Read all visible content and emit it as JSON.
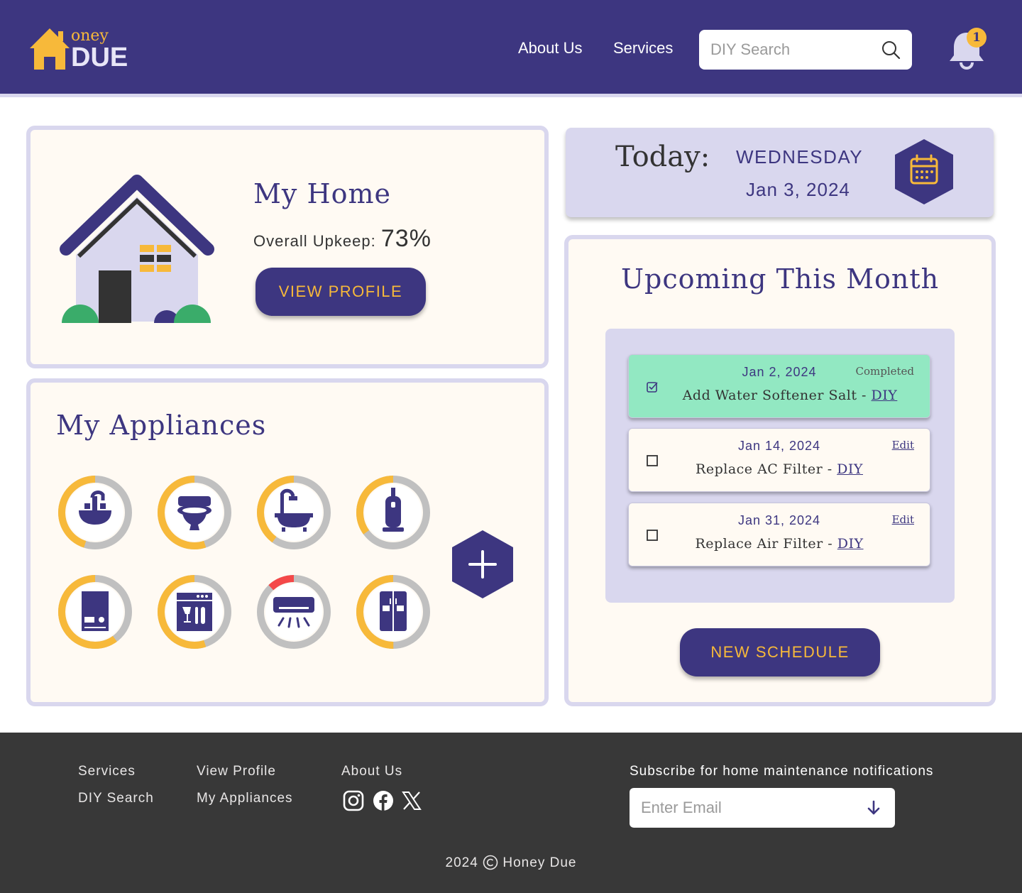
{
  "header": {
    "logo_top": "oney",
    "logo_bottom": "DUE",
    "nav": [
      {
        "label": "About Us",
        "icon": "none"
      },
      {
        "label": "Services",
        "icon": "none"
      }
    ],
    "search_placeholder": "DIY Search",
    "notification_count": "1"
  },
  "home": {
    "title": "My Home",
    "upkeep_label": "Overall Upkeep:",
    "upkeep_value": "73%",
    "view_profile_label": "VIEW PROFILE"
  },
  "appliances": {
    "title": "My Appliances",
    "items": [
      {
        "name": "sink",
        "icon": "sink-icon",
        "level": 0.45,
        "status_color": "#f7b93a"
      },
      {
        "name": "toilet",
        "icon": "toilet-icon",
        "level": 0.55,
        "status_color": "#f7b93a"
      },
      {
        "name": "bathtub",
        "icon": "bathtub-icon",
        "level": 0.4,
        "status_color": "#f7b93a"
      },
      {
        "name": "vacuum",
        "icon": "vacuum-icon",
        "level": 0.35,
        "status_color": "#f7b93a"
      },
      {
        "name": "water-heater",
        "icon": "boiler-icon",
        "level": 0.6,
        "status_color": "#f7b93a"
      },
      {
        "name": "dishwasher",
        "icon": "dishwasher-icon",
        "level": 0.55,
        "status_color": "#f7b93a"
      },
      {
        "name": "air-conditioner",
        "icon": "ac-icon",
        "level": 0.12,
        "status_color": "#f44848"
      },
      {
        "name": "refrigerator",
        "icon": "fridge-icon",
        "level": 0.5,
        "status_color": "#f7b93a"
      }
    ],
    "colors": {
      "track": "#c0c0c0",
      "icon": "#3d3680"
    }
  },
  "today": {
    "label": "Today:",
    "day": "WEDNESDAY",
    "date": "Jan 3, 2024"
  },
  "upcoming": {
    "title": "Upcoming This Month",
    "tasks": [
      {
        "date": "Jan 2, 2024",
        "name": "Add Water Softener Salt - ",
        "link": "DIY",
        "status": "Completed",
        "done": true
      },
      {
        "date": "Jan 14, 2024",
        "name": "Replace AC Filter - ",
        "link": "DIY",
        "status": "Edit",
        "done": false
      },
      {
        "date": "Jan 31, 2024",
        "name": "Replace Air Filter - ",
        "link": "DIY",
        "status": "Edit",
        "done": false
      }
    ],
    "new_schedule_label": "NEW SCHEDULE"
  },
  "footer": {
    "links_col1": [
      "Services",
      "DIY Search"
    ],
    "links_col2": [
      "View Profile",
      "My Appliances"
    ],
    "links_col3": [
      "About Us"
    ],
    "social": [
      "instagram-icon",
      "facebook-icon",
      "x-icon"
    ],
    "subscribe_text": "Subscribe for home maintenance notifications",
    "email_placeholder": "Enter Email",
    "copyright_year": "2024",
    "copyright_owner": "Honey Due"
  },
  "colors": {
    "brand": "#3d3680",
    "accent": "#f7b93a",
    "light": "#d9d7ee",
    "done": "#92e8c2",
    "footer": "#383838"
  }
}
